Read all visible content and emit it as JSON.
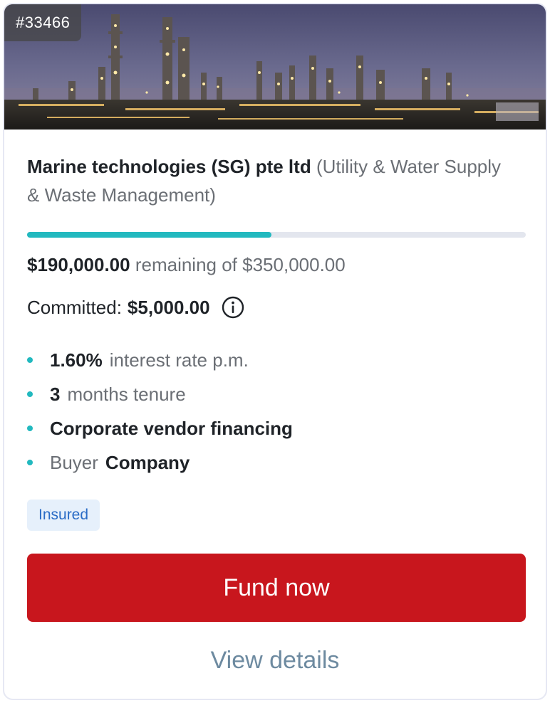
{
  "listing": {
    "id": "#33466",
    "company": "Marine technologies (SG) pte ltd",
    "sector": "(Utility & Water Supply & Waste Management)",
    "progress_fraction": 0.49,
    "remaining_amount": "$190,000.00",
    "remaining_text": "remaining of $350,000.00",
    "committed_label": "Committed:",
    "committed_amount": "$5,000.00",
    "info_icon": "info-icon",
    "features": {
      "rate_value": "1.60%",
      "rate_text": "interest rate p.m.",
      "tenure_value": "3",
      "tenure_text": "months tenure",
      "financing_type": "Corporate vendor financing",
      "buyer_label": "Buyer",
      "buyer_value": "Company"
    },
    "tag": "Insured",
    "primary_action": "Fund now",
    "secondary_action": "View details"
  },
  "colors": {
    "accent": "#22b9bf",
    "primary_button": "#c8161d",
    "tag_background": "#e6f0fb",
    "tag_text": "#2a6cc6",
    "link": "#6d8aa0"
  }
}
